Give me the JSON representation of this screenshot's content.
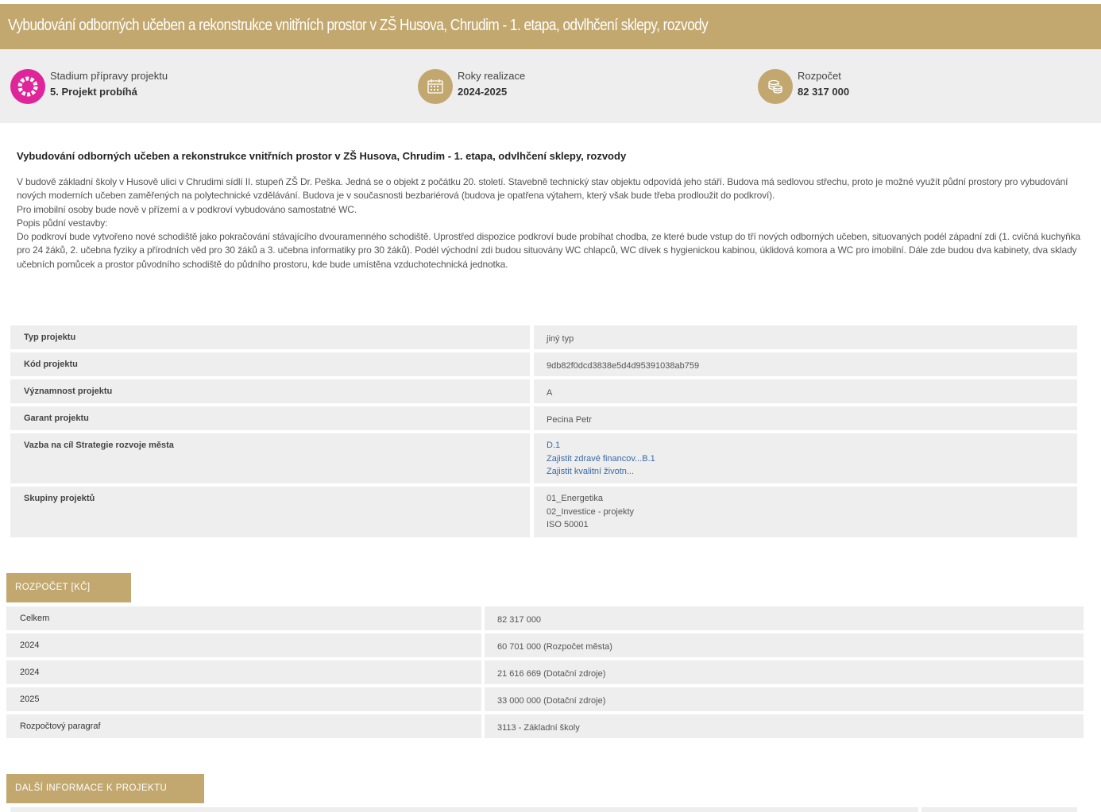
{
  "header": {
    "title": "Vybudování odborných učeben a rekonstrukce vnitřních prostor v ZŠ Husova, Chrudim - 1. etapa, odvlhčení sklepy, rozvody"
  },
  "stats": [
    {
      "label": "Stadium přípravy projektu",
      "value": "5. Projekt probíhá",
      "icon": "progress-ring-icon",
      "color": "#e0259b"
    },
    {
      "label": "Roky realizace",
      "value": "2024-2025",
      "icon": "calendar-icon",
      "color": "#c2a86f"
    },
    {
      "label": "Rozpočet",
      "value": "82 317 000",
      "icon": "coins-icon",
      "color": "#c2a86f"
    }
  ],
  "intro": {
    "title": "Vybudování odborných učeben a rekonstrukce vnitřních prostor v ZŠ Husova, Chrudim - 1. etapa, odvlhčení sklepy, rozvody",
    "paragraphs": [
      "V budově základní školy v Husově ulici v Chrudimi sídlí II. stupeň ZŠ Dr. Peška. Jedná se o objekt z počátku 20. století. Stavebně technický stav objektu odpovídá jeho stáří. Budova má sedlovou střechu, proto je možné využít půdní prostory pro vybudování nových moderních učeben zaměřených na polytechnické vzdělávání. Budova je v současnosti bezbariérová (budova je opatřena výtahem, který však bude třeba prodloužit do podkroví).",
      "Pro imobilní osoby bude nově v přízemí a v podkroví vybudováno samostatné WC.",
      "Popis půdní vestavby:",
      "Do podkroví bude vytvořeno nové schodiště jako pokračování stávajícího dvouramenného schodiště. Uprostřed dispozice podkroví bude probíhat chodba, ze které bude vstup do tří nových odborných učeben, situovaných podél západní zdi (1. cvičná kuchyňka pro 24 žáků, 2. učebna fyziky a přírodních věd pro 30 žáků a 3. učebna informatiky pro 30 žáků). Podél východní zdi budou situovány WC chlapců, WC dívek s hygienickou kabinou, úklidová komora a WC pro imobilní. Dále zde budou dva kabinety, dva sklady učebních pomůcek a prostor původního schodiště do půdního prostoru, kde bude umístěna vzduchotechnická jednotka."
    ]
  },
  "info": {
    "type_label": "Typ projektu",
    "type_value": "jiný typ",
    "code_label": "Kód projektu",
    "code_value": "9db82f0dcd3838e5d4d95391038ab759",
    "importance_label": "Významnost projektu",
    "importance_value": "A",
    "guarantor_label": "Garant projektu",
    "guarantor_value": "Pecina Petr",
    "strategy_label": "Vazba na cíl Strategie rozvoje města",
    "strategy_links": [
      "D.1",
      "Zajistit zdravé financov...B.1",
      "Zajistit kvalitní životn..."
    ],
    "groups_label": "Skupiny projektů",
    "groups": [
      "01_Energetika",
      "02_Investice - projekty",
      "ISO 50001"
    ]
  },
  "budget": {
    "tab_label": "Rozpočet [Kč]",
    "rows": [
      {
        "label": "Celkem",
        "value": "82 317 000"
      },
      {
        "label": "2024",
        "value": "60 701 000 (Rozpočet města)"
      },
      {
        "label": "2024",
        "value": "21 616 669 (Dotační zdroje)"
      },
      {
        "label": "2025",
        "value": "33 000 000 (Dotační zdroje)"
      },
      {
        "label": "Rozpočtový paragraf",
        "value": "3113 - Základní školy"
      }
    ]
  },
  "more": {
    "tab_label": "Další informace k projektu"
  }
}
